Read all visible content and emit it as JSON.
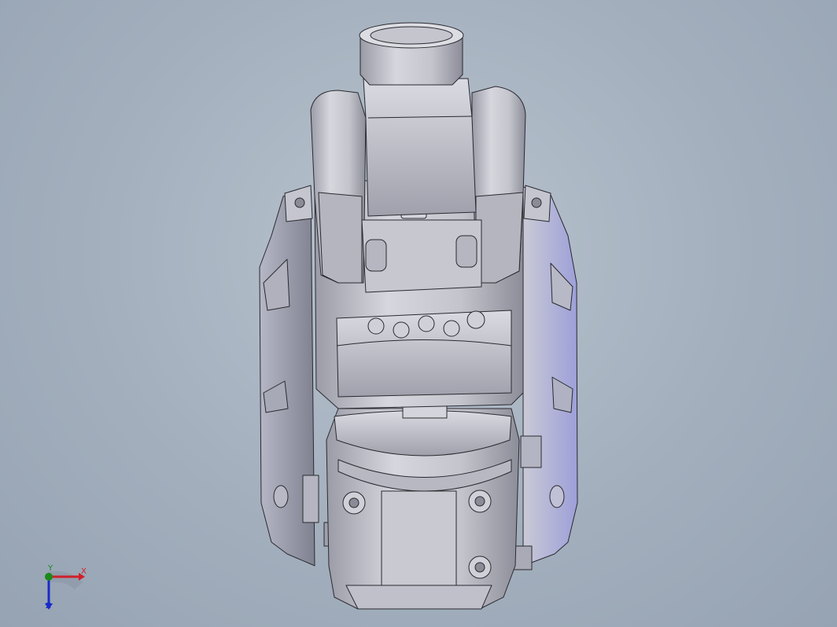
{
  "viewport": {
    "background_colors": [
      "#b9c3cf",
      "#96a3b3"
    ],
    "model": {
      "subject": "robot-arm-assembly",
      "body_color": "#c8c9d1",
      "shadow_color": "#8a8b96",
      "edge_color": "#2a2a30"
    }
  },
  "triad": {
    "x_label": "X",
    "y_label": "Y",
    "z_label": "Z",
    "x_color": "#d0202a",
    "y_color": "#1a8a1a",
    "z_color": "#1a2ac8"
  }
}
